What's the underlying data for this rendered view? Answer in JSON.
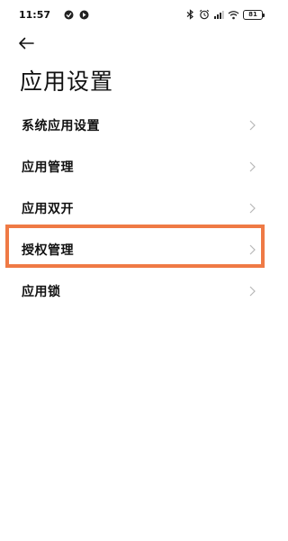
{
  "status_bar": {
    "time": "11:57",
    "battery": "81",
    "left_icons": [
      "app-notification-icon",
      "app-notification-icon-2"
    ],
    "right_icons": [
      "bluetooth-icon",
      "alarm-icon",
      "signal-icon",
      "wifi-icon",
      "battery-icon"
    ]
  },
  "header": {
    "back_icon": "arrow-left-icon",
    "title": "应用设置"
  },
  "menu": {
    "items": [
      {
        "label": "系统应用设置"
      },
      {
        "label": "应用管理"
      },
      {
        "label": "应用双开"
      },
      {
        "label": "授权管理",
        "highlighted": true
      },
      {
        "label": "应用锁"
      }
    ]
  },
  "colors": {
    "highlight_border": "#ef7a45",
    "chevron": "#b8b8b8",
    "text": "#111111"
  }
}
